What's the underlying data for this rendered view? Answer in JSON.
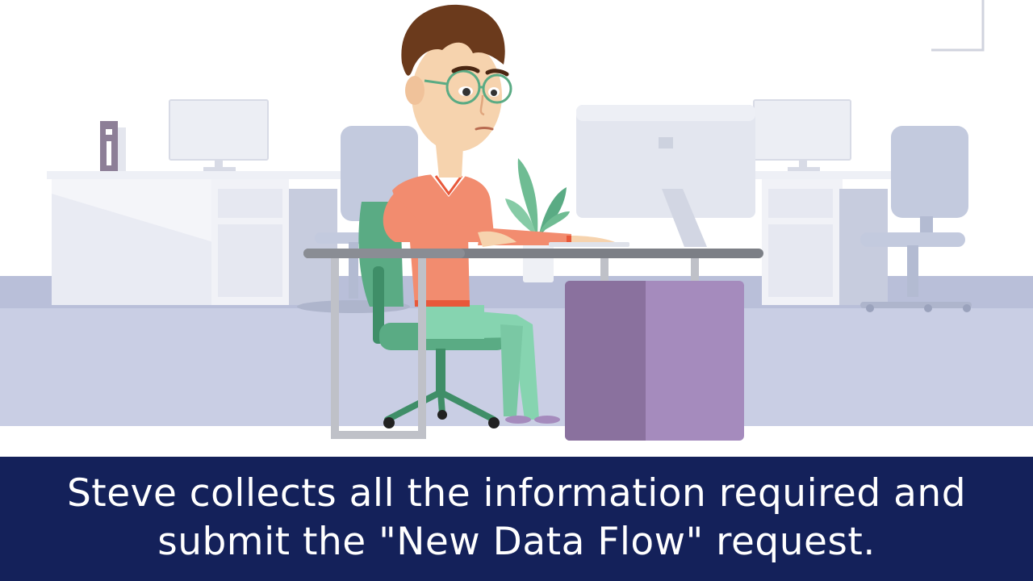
{
  "caption": {
    "line1": "Steve collects all the information required and",
    "line2": "submit the \"New Data Flow\" request."
  },
  "scene": {
    "character": "steve",
    "setting": "office",
    "colors": {
      "floor": "#c9cee4",
      "back_floor": "#b9bfd9",
      "caption_background": "#14215a",
      "shirt": "#f28c6f",
      "pants": "#86d4b0",
      "chair": "#5aab84",
      "cabinet": "#a58bbd",
      "cabinet_shade": "#8a719e"
    }
  }
}
